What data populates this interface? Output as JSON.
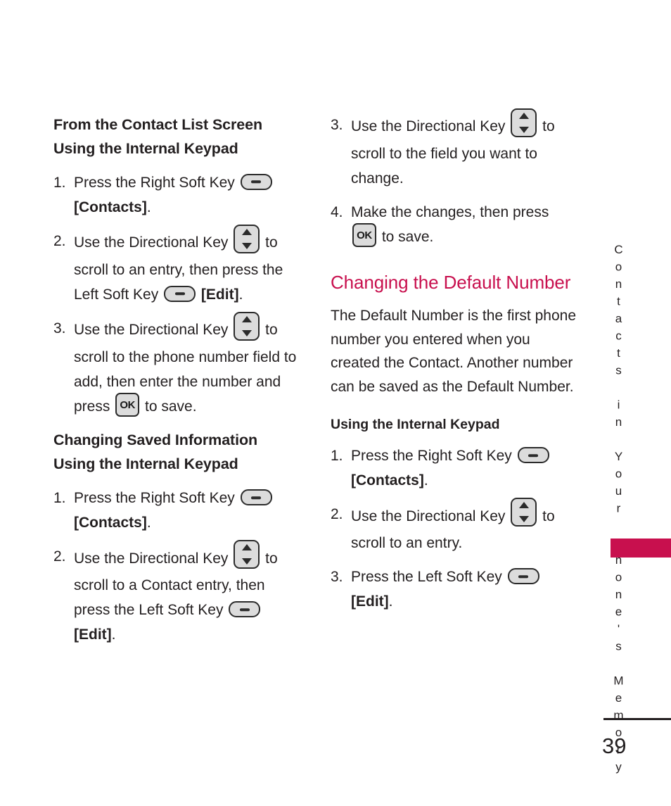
{
  "page": {
    "number": "39",
    "running_head": "Contacts in Your Phone's Memory",
    "accent_color": "#c8104e",
    "text_color": "#231f20"
  },
  "icons": {
    "soft_key": "soft-key-icon",
    "directional_key": "directional-key-icon",
    "ok_key": "ok-key-icon",
    "ok_label": "OK"
  },
  "left_column": {
    "heading": "From the Contact List Screen Using the Internal Keypad",
    "steps": [
      {
        "num": "1.",
        "parts": [
          {
            "type": "text",
            "value": "Press the Right Soft Key "
          },
          {
            "type": "icon",
            "value": "soft-key-icon"
          },
          {
            "type": "text",
            "value": " "
          },
          {
            "type": "bold",
            "value": "[Contacts]"
          },
          {
            "type": "text",
            "value": "."
          }
        ]
      },
      {
        "num": "2.",
        "parts": [
          {
            "type": "text",
            "value": "Use the Directional Key "
          },
          {
            "type": "icon",
            "value": "directional-key-icon"
          },
          {
            "type": "text",
            "value": " to scroll to an entry, then press the Left Soft Key "
          },
          {
            "type": "icon",
            "value": "soft-key-icon"
          },
          {
            "type": "text",
            "value": " "
          },
          {
            "type": "bold",
            "value": "[Edit]"
          },
          {
            "type": "text",
            "value": "."
          }
        ]
      },
      {
        "num": "3.",
        "parts": [
          {
            "type": "text",
            "value": "Use the Directional Key "
          },
          {
            "type": "icon",
            "value": "directional-key-icon"
          },
          {
            "type": "text",
            "value": " to scroll to the phone number field to add, then enter the number and press "
          },
          {
            "type": "icon",
            "value": "ok-key-icon"
          },
          {
            "type": "text",
            "value": " to save."
          }
        ]
      }
    ],
    "heading2": "Changing Saved Information Using the Internal Keypad",
    "steps2": [
      {
        "num": "1.",
        "parts": [
          {
            "type": "text",
            "value": "Press the Right Soft Key "
          },
          {
            "type": "icon",
            "value": "soft-key-icon"
          },
          {
            "type": "text",
            "value": " "
          },
          {
            "type": "bold",
            "value": "[Contacts]"
          },
          {
            "type": "text",
            "value": "."
          }
        ]
      },
      {
        "num": "2.",
        "parts": [
          {
            "type": "text",
            "value": "Use the Directional Key "
          },
          {
            "type": "icon",
            "value": "directional-key-icon"
          },
          {
            "type": "text",
            "value": " to scroll to a Contact entry, then press the Left Soft Key "
          },
          {
            "type": "icon",
            "value": "soft-key-icon"
          },
          {
            "type": "text",
            "value": " "
          },
          {
            "type": "bold",
            "value": "[Edit]"
          },
          {
            "type": "text",
            "value": "."
          }
        ]
      }
    ]
  },
  "right_column": {
    "steps_continued": [
      {
        "num": "3.",
        "parts": [
          {
            "type": "text",
            "value": "Use the Directional Key "
          },
          {
            "type": "icon",
            "value": "directional-key-icon"
          },
          {
            "type": "text",
            "value": " to scroll to the field you want to change."
          }
        ]
      },
      {
        "num": "4.",
        "parts": [
          {
            "type": "text",
            "value": "Make the changes, then press "
          },
          {
            "type": "icon",
            "value": "ok-key-icon"
          },
          {
            "type": "text",
            "value": " to save."
          }
        ]
      }
    ],
    "heading_pink": "Changing the Default Number",
    "paragraph": "The Default Number is the first phone number you entered when you created the Contact. Another number can be saved as the Default Number.",
    "sub_heading": "Using the Internal Keypad",
    "steps": [
      {
        "num": "1.",
        "parts": [
          {
            "type": "text",
            "value": "Press the Right Soft Key "
          },
          {
            "type": "icon",
            "value": "soft-key-icon"
          },
          {
            "type": "text",
            "value": " "
          },
          {
            "type": "bold",
            "value": "[Contacts]"
          },
          {
            "type": "text",
            "value": "."
          }
        ]
      },
      {
        "num": "2.",
        "parts": [
          {
            "type": "text",
            "value": "Use the Directional Key "
          },
          {
            "type": "icon",
            "value": "directional-key-icon"
          },
          {
            "type": "text",
            "value": " to scroll to an entry."
          }
        ]
      },
      {
        "num": "3.",
        "parts": [
          {
            "type": "text",
            "value": "Press the Left Soft Key "
          },
          {
            "type": "icon",
            "value": "soft-key-icon"
          },
          {
            "type": "text",
            "value": " "
          },
          {
            "type": "bold",
            "value": "[Edit]"
          },
          {
            "type": "text",
            "value": "."
          }
        ]
      }
    ]
  }
}
